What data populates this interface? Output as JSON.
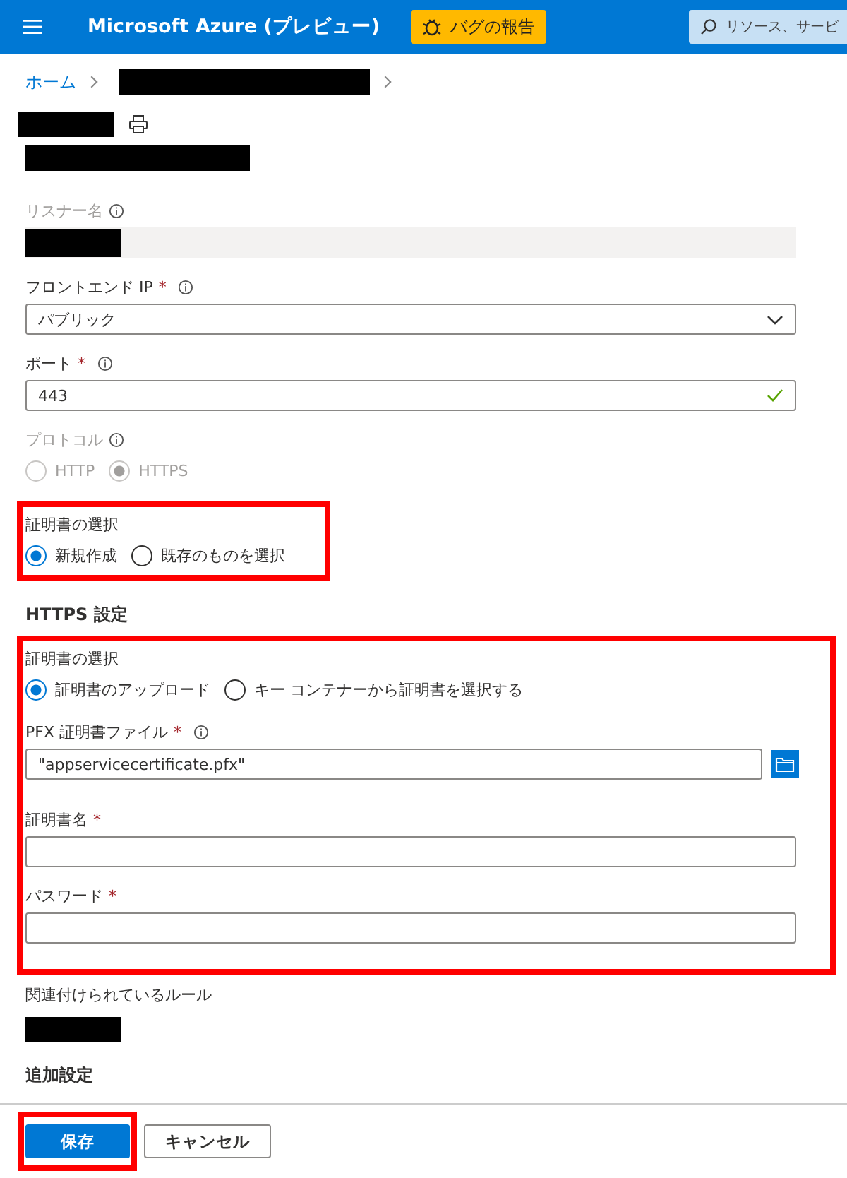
{
  "header": {
    "title": "Microsoft Azure (プレビュー)",
    "bug_button": "バグの報告",
    "search": {
      "placeholder": "リソース、サービ"
    }
  },
  "breadcrumb": [
    {
      "label": "ホーム"
    }
  ],
  "listener_name": {
    "label": "リスナー名",
    "disabled": true
  },
  "frontend_ip": {
    "label": "フロントエンド IP",
    "required_mark": "*",
    "value": "パブリック"
  },
  "port": {
    "label": "ポート",
    "required_mark": "*",
    "value": "443",
    "valid": true
  },
  "protocol": {
    "label": "プロトコル",
    "disabled": true,
    "options": [
      {
        "label": "HTTP",
        "selected": false
      },
      {
        "label": "HTTPS",
        "selected": true
      }
    ]
  },
  "certificate_choice": {
    "label": "証明書の選択",
    "highlighted": true,
    "options": [
      {
        "label": "新規作成",
        "selected": true
      },
      {
        "label": "既存のものを選択",
        "selected": false
      }
    ]
  },
  "https_settings": {
    "heading": "HTTPS 設定",
    "highlighted": true,
    "certificate_source": {
      "label": "証明書の選択",
      "options": [
        {
          "label": "証明書のアップロード",
          "selected": true
        },
        {
          "label": "キー コンテナーから証明書を選択する",
          "selected": false
        }
      ]
    },
    "pfx_file": {
      "label": "PFX 証明書ファイル",
      "required_mark": "*",
      "value": "\"appservicecertificate.pfx\""
    },
    "certificate_name": {
      "label": "証明書名",
      "required_mark": "*"
    },
    "password": {
      "label": "パスワード",
      "required_mark": "*"
    }
  },
  "associated_rules": {
    "label": "関連付けられているルール"
  },
  "additional_settings": {
    "heading": "追加設定"
  },
  "footer": {
    "buttons": [
      {
        "label": "保存",
        "kind": "primary",
        "highlighted": true
      },
      {
        "label": "キャンセル",
        "kind": "secondary",
        "highlighted": false
      }
    ]
  }
}
